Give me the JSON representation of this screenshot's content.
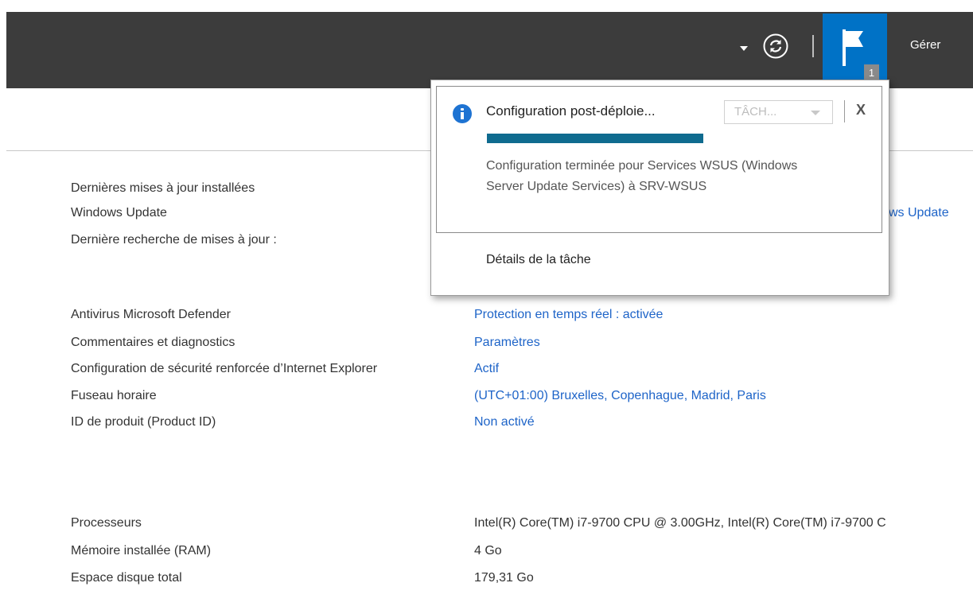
{
  "header": {
    "manage_label": "Gérer",
    "notification_count": "1",
    "flag_color": "#0072c6",
    "bar_color": "#3c3c3c",
    "icons": [
      "chevron-down-icon",
      "refresh-icon",
      "flag-icon"
    ]
  },
  "properties": {
    "section1": [
      {
        "label": "Dernières mises à jour installées",
        "value": ""
      },
      {
        "label": "Windows Update",
        "value": "ws Update"
      },
      {
        "label": "Dernière recherche de mises à jour :",
        "value": ""
      }
    ],
    "section2": [
      {
        "label": "Antivirus Microsoft Defender",
        "value": "Protection en temps réel : activée"
      },
      {
        "label": "Commentaires et diagnostics",
        "value": "Paramètres"
      },
      {
        "label": "Configuration de sécurité renforcée d’Internet Explorer",
        "value": "Actif"
      },
      {
        "label": "Fuseau horaire",
        "value": "(UTC+01:00) Bruxelles, Copenhague, Madrid, Paris"
      },
      {
        "label": "ID de produit (Product ID)",
        "value": "Non activé"
      }
    ],
    "section3": [
      {
        "label": "Processeurs",
        "value": "Intel(R) Core(TM) i7-9700 CPU @ 3.00GHz, Intel(R) Core(TM) i7-9700 C"
      },
      {
        "label": "Mémoire installée (RAM)",
        "value": "4 Go"
      },
      {
        "label": "Espace disque total",
        "value": "179,31 Go"
      }
    ]
  },
  "notification": {
    "title": "Configuration post-déploie...",
    "task_select_label": "TÂCH...",
    "close_label": "X",
    "progress": 1.0,
    "progress_color": "#0f6b8f",
    "message": "Configuration terminée pour Services WSUS (Windows Server Update Services) à SRV-WSUS",
    "details_link": "Détails de la tâche",
    "icon": "info-icon"
  }
}
